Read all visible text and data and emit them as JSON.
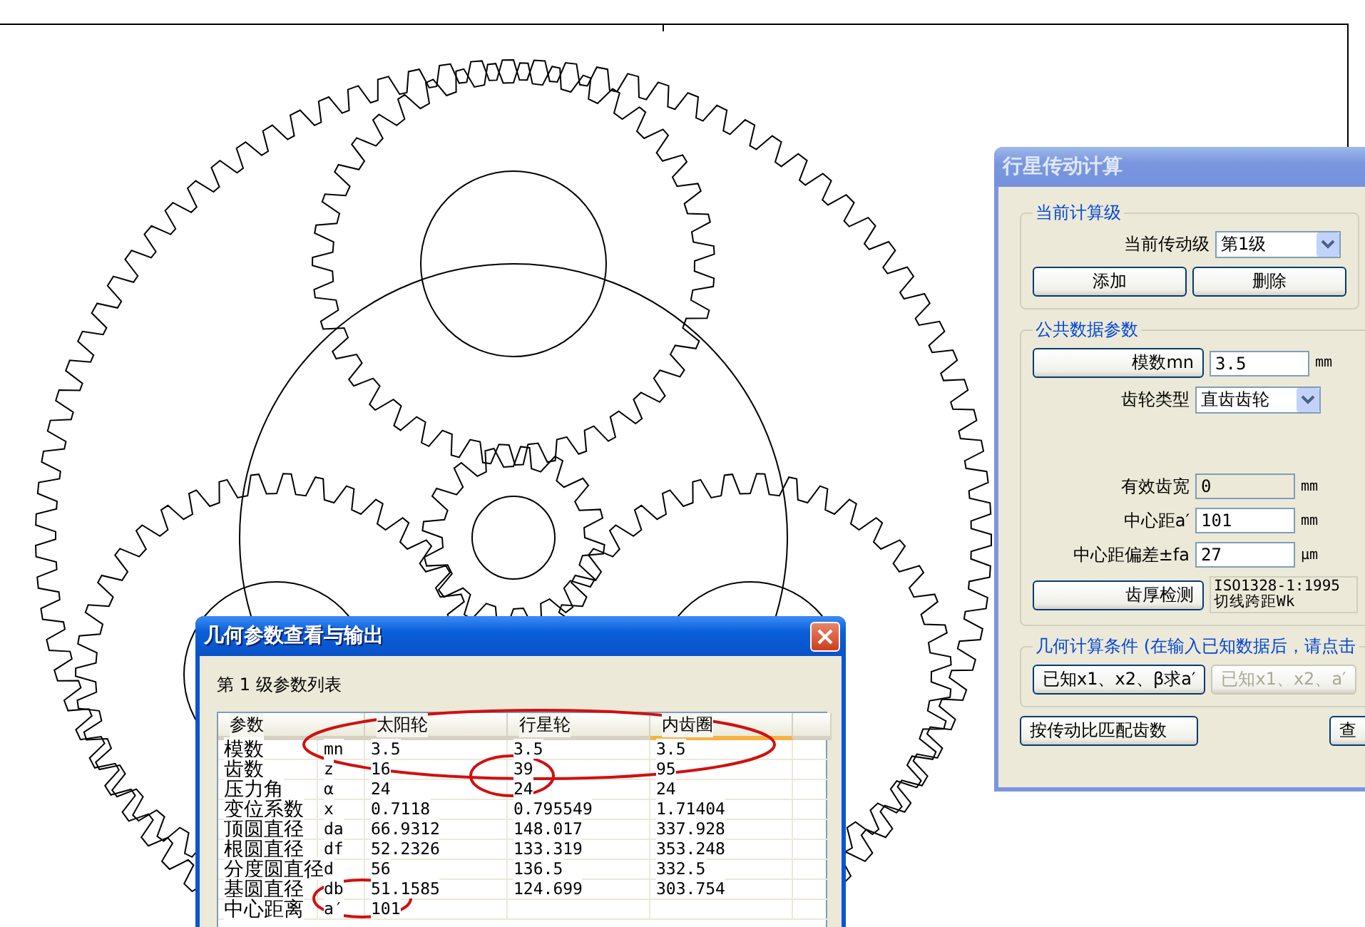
{
  "planetary_window": {
    "title": "行星传动计算",
    "active": false,
    "stage_group": {
      "title": "当前计算级",
      "stage_label": "当前传动级",
      "stage_value": "第1级",
      "buttons": [
        "添加",
        "删除"
      ]
    },
    "common_group": {
      "title": "公共数据参数",
      "fields_top": [
        {
          "kind": "button_field",
          "label": "模数mn",
          "value": "3.5",
          "unit": "mm"
        },
        {
          "kind": "select",
          "label": "齿轮类型",
          "value": "直齿齿轮"
        }
      ],
      "fields_bottom": [
        {
          "kind": "field",
          "label": "有效齿宽",
          "value": "0",
          "unit": "mm",
          "disabled": true
        },
        {
          "kind": "field",
          "label": "中心距a′",
          "value": "101",
          "unit": "mm",
          "disabled": false
        },
        {
          "kind": "field",
          "label": "中心距偏差±fa",
          "value": "27",
          "unit": "μm",
          "disabled": false
        },
        {
          "kind": "button_note",
          "label": "齿厚检测",
          "note": [
            "ISO1328-1:1995",
            "切线跨距Wk"
          ]
        }
      ]
    },
    "geometry_group": {
      "title": "几何计算条件 (在输入已知数据后，请点击",
      "buttons": [
        {
          "label": "已知x1、x2、β求a′",
          "disabled": false
        },
        {
          "label": "已知x1、x2、a′",
          "disabled": true
        }
      ]
    },
    "bottom_buttons": [
      "按传动比匹配齿数",
      "查"
    ]
  },
  "table_window": {
    "title": "几何参数查看与输出",
    "active": true,
    "caption": "第 1 级参数列表",
    "columns": [
      {
        "label": "参数",
        "hot": false
      },
      {
        "label": "太阳轮",
        "hot": false
      },
      {
        "label": "行星轮",
        "hot": false
      },
      {
        "label": "内齿圈",
        "hot": true
      }
    ],
    "rows": [
      {
        "name": "模数",
        "symbol": "mn",
        "values": [
          "3.5",
          "3.5",
          "3.5"
        ]
      },
      {
        "name": "齿数",
        "symbol": "z",
        "values": [
          "16",
          "39",
          "95"
        ]
      },
      {
        "name": "压力角",
        "symbol": "α",
        "values": [
          "24",
          "24",
          "24"
        ]
      },
      {
        "name": "变位系数",
        "symbol": "x",
        "values": [
          "0.7118",
          "0.795549",
          "1.71404"
        ]
      },
      {
        "name": "顶圆直径",
        "symbol": "da",
        "values": [
          "66.9312",
          "148.017",
          "337.928"
        ]
      },
      {
        "name": "根圆直径",
        "symbol": "df",
        "values": [
          "52.2326",
          "133.319",
          "353.248"
        ]
      },
      {
        "name": "分度圆直径",
        "symbol": "d",
        "values": [
          "56",
          "136.5",
          "332.5"
        ]
      },
      {
        "name": "基圆直径",
        "symbol": "db",
        "values": [
          "51.1585",
          "124.699",
          "303.754"
        ]
      },
      {
        "name": "中心距离",
        "symbol": "a′",
        "values": [
          "101"
        ]
      }
    ]
  }
}
